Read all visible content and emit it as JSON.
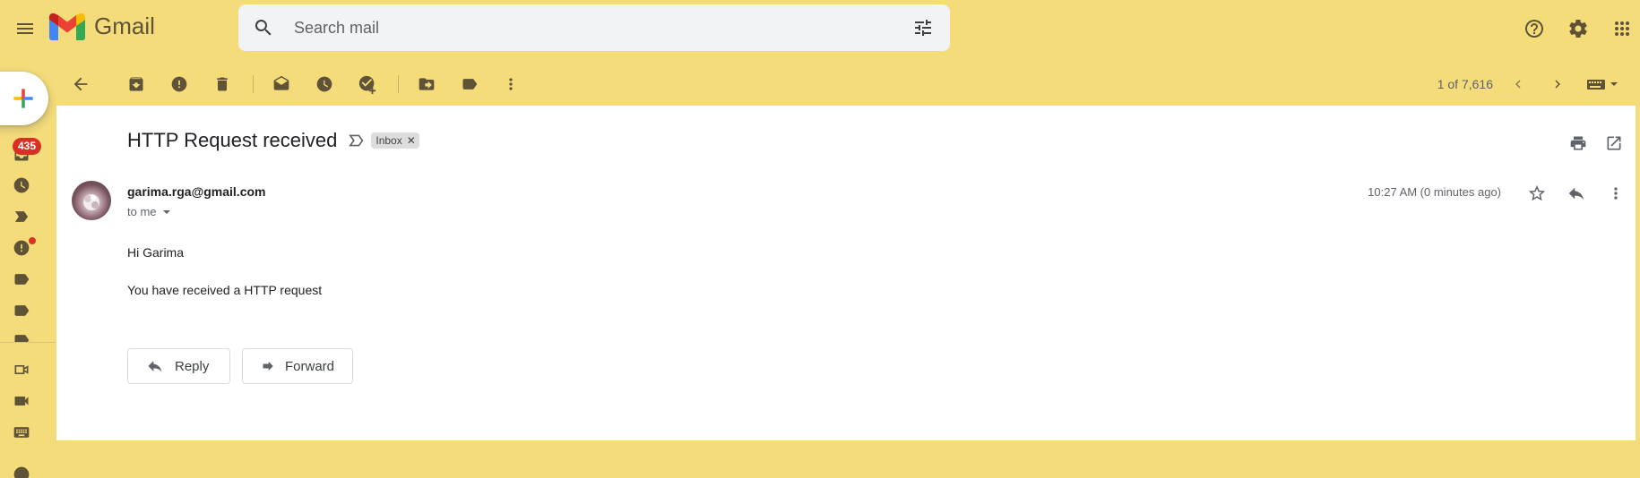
{
  "app": {
    "name": "Gmail"
  },
  "search": {
    "placeholder": "Search mail"
  },
  "rail": {
    "unread_badge": "435"
  },
  "pager": {
    "text": "1 of 7,616"
  },
  "mail": {
    "subject": "HTTP Request received",
    "label_chip": "Inbox",
    "sender": "garima.rga@gmail.com",
    "recipient": "to me",
    "time": "10:27 AM (0 minutes ago)",
    "body_lines": [
      "Hi Garima",
      "You have received a HTTP request"
    ],
    "reply_label": "Reply",
    "forward_label": "Forward"
  },
  "colors": {
    "theme_background": "#f5dc7a",
    "card_background": "#ffffff",
    "badge_red": "#d93025",
    "icon_dark": "#5f5337"
  },
  "icons": [
    "hamburger-menu-icon",
    "gmail-logo-icon",
    "search-icon",
    "tune-icon",
    "help-icon",
    "gear-icon",
    "apps-grid-icon",
    "compose-plus-icon",
    "inbox-icon",
    "clock-icon",
    "important-icon",
    "spam-icon",
    "label-icon",
    "video-icon",
    "keyboard-icon",
    "back-arrow-icon",
    "archive-icon",
    "report-spam-icon",
    "delete-icon",
    "mark-unread-icon",
    "snooze-icon",
    "add-task-icon",
    "move-to-icon",
    "labels-icon",
    "more-vert-icon",
    "chevron-left-icon",
    "chevron-right-icon",
    "input-tools-icon",
    "print-icon",
    "open-in-new-icon",
    "star-icon",
    "reply-icon",
    "forward-icon"
  ]
}
